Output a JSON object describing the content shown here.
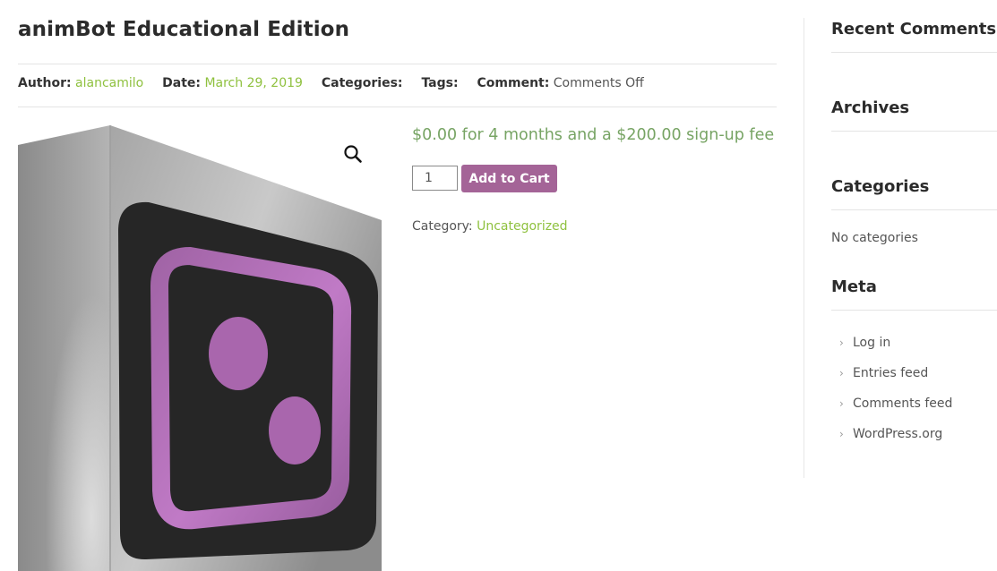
{
  "post": {
    "title": "animBot Educational Edition",
    "meta": {
      "author_label": "Author:",
      "author_value": "alancamilo",
      "date_label": "Date:",
      "date_value": "March 29, 2019",
      "categories_label": "Categories:",
      "tags_label": "Tags:",
      "comment_label": "Comment:",
      "comment_value": "Comments Off"
    }
  },
  "product": {
    "image_icon": "animbot-logo-box",
    "zoom_icon": "magnifier-icon",
    "price": "$0.00 for 4 months and a $200.00 sign-up fee",
    "quantity": "1",
    "add_to_cart_label": "Add to Cart",
    "category_label": "Category:",
    "category_value": "Uncategorized"
  },
  "sidebar": {
    "recent_comments_title": "Recent Comments",
    "archives_title": "Archives",
    "categories_title": "Categories",
    "categories_empty": "No categories",
    "meta_title": "Meta",
    "meta_links": [
      "Log in",
      "Entries feed",
      "Comments feed",
      "WordPress.org"
    ]
  },
  "colors": {
    "link_green": "#8fc13f",
    "price_green": "#77a464",
    "button_purple": "#a46497",
    "logo_purple": "#b06cb6",
    "logo_dark": "#262626"
  }
}
